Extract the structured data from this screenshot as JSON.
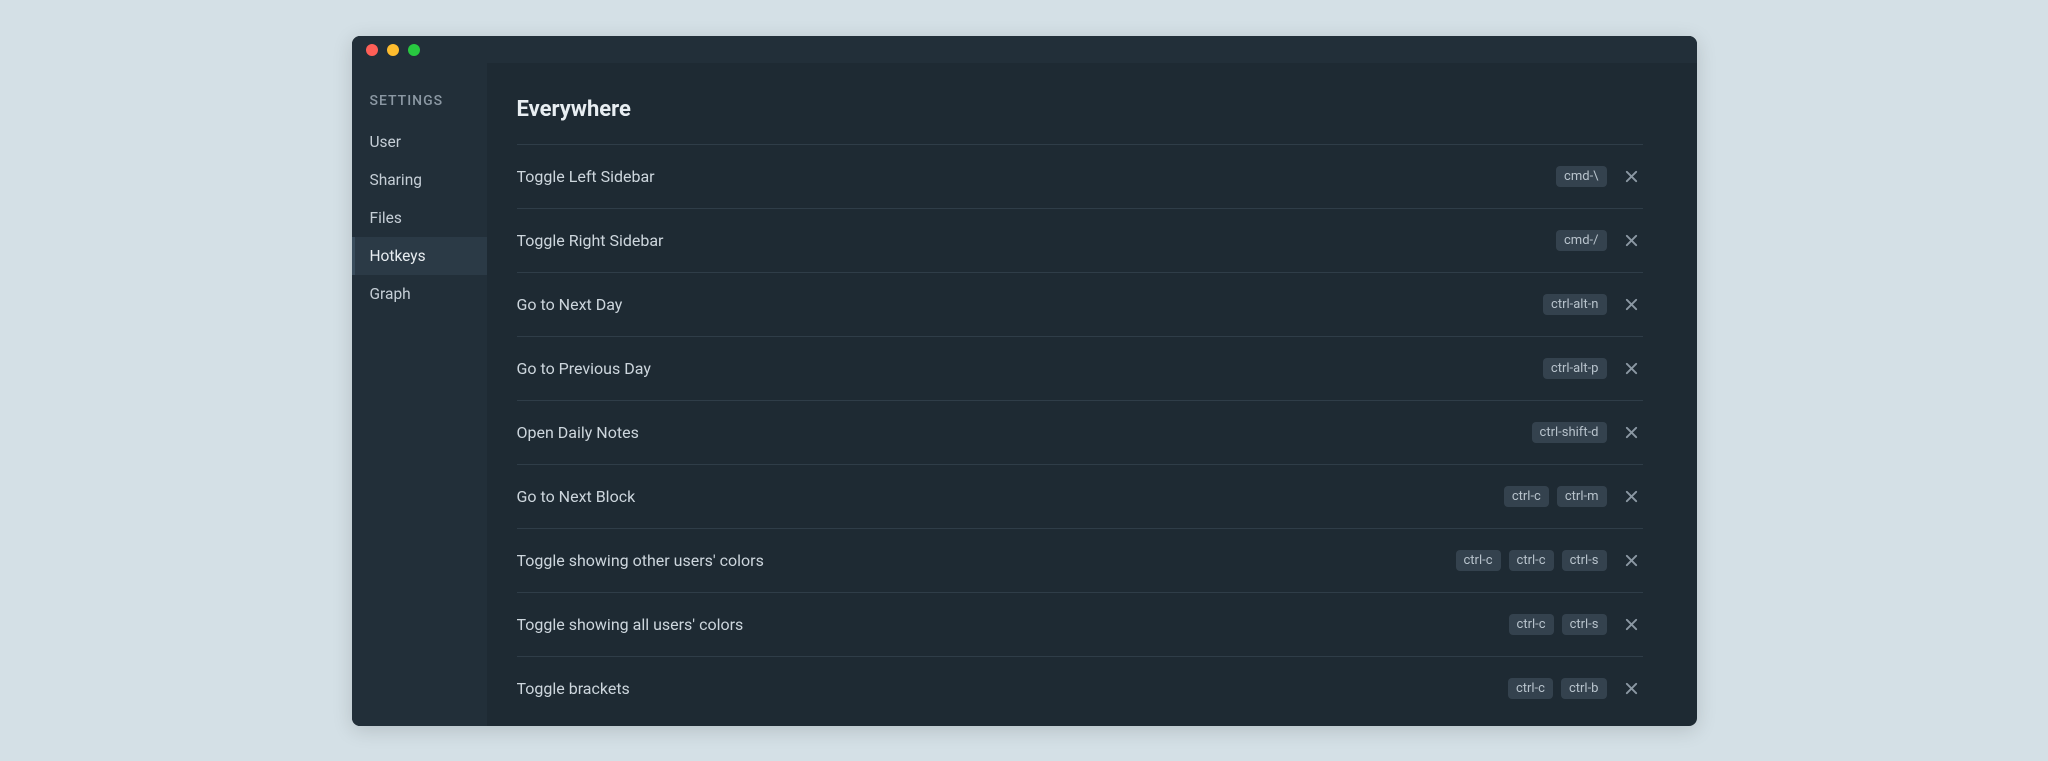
{
  "sidebar": {
    "heading": "SETTINGS",
    "items": [
      {
        "label": "User",
        "active": false
      },
      {
        "label": "Sharing",
        "active": false
      },
      {
        "label": "Files",
        "active": false
      },
      {
        "label": "Hotkeys",
        "active": true
      },
      {
        "label": "Graph",
        "active": false
      }
    ]
  },
  "main": {
    "heading": "Everywhere",
    "hotkeys": [
      {
        "label": "Toggle Left Sidebar",
        "keys": [
          "cmd-\\"
        ]
      },
      {
        "label": "Toggle Right Sidebar",
        "keys": [
          "cmd-/"
        ]
      },
      {
        "label": "Go to Next Day",
        "keys": [
          "ctrl-alt-n"
        ]
      },
      {
        "label": "Go to Previous Day",
        "keys": [
          "ctrl-alt-p"
        ]
      },
      {
        "label": "Open Daily Notes",
        "keys": [
          "ctrl-shift-d"
        ]
      },
      {
        "label": "Go to Next Block",
        "keys": [
          "ctrl-c",
          "ctrl-m"
        ]
      },
      {
        "label": "Toggle showing other users' colors",
        "keys": [
          "ctrl-c",
          "ctrl-c",
          "ctrl-s"
        ]
      },
      {
        "label": "Toggle showing all users' colors",
        "keys": [
          "ctrl-c",
          "ctrl-s"
        ]
      },
      {
        "label": "Toggle brackets",
        "keys": [
          "ctrl-c",
          "ctrl-b"
        ]
      }
    ]
  }
}
